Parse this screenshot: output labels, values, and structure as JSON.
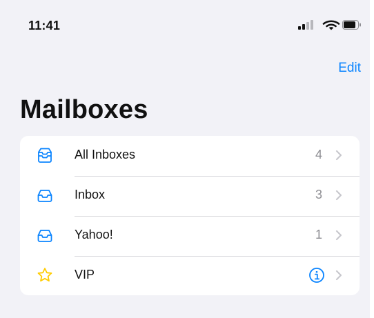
{
  "status_bar": {
    "time": "11:41"
  },
  "navigation": {
    "edit_label": "Edit",
    "title": "Mailboxes"
  },
  "mailboxes": [
    {
      "label": "All Inboxes",
      "count": "4",
      "icon": "all-inboxes-icon"
    },
    {
      "label": "Inbox",
      "count": "3",
      "icon": "inbox-icon"
    },
    {
      "label": "Yahoo!",
      "count": "1",
      "icon": "inbox-icon"
    },
    {
      "label": "VIP",
      "count": "",
      "icon": "star-icon",
      "trailing_icon": "info-icon"
    }
  ],
  "colors": {
    "accent": "#0a84ff",
    "star": "#ffcc00",
    "background": "#f2f2f7",
    "secondary_text": "#8e8e93",
    "chevron": "#c7c7cc"
  }
}
